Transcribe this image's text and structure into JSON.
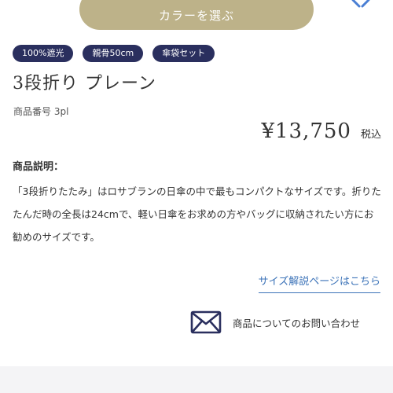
{
  "top_button": {
    "label": "カラーを選ぶ"
  },
  "tags": [
    "100%遮光",
    "親骨50cm",
    "傘袋セット"
  ],
  "product": {
    "title": "3段折り プレーン",
    "number": "商品番号 3pl",
    "price": "¥13,750",
    "tax_label": "税込"
  },
  "description": {
    "heading": "商品説明：",
    "body": "「3段折りたたみ」はロサブランの日傘の中で最もコンパクトなサイズです。折りたたんだ時の全長は24cmで、軽い日傘をお求めの方やバッグに収納されたい方にお勧めのサイズです。"
  },
  "links": {
    "size_guide": "サイズ解説ページはこちら",
    "inquiry": "商品についてのお問い合わせ"
  },
  "colors": {
    "button": "#bdb289",
    "tag": "#2a2f5e",
    "link": "#3c73b8",
    "icon": "#2a2f5e",
    "corner_icon": "#4a7fd4",
    "footer": "#f4f4f6"
  },
  "icons": {
    "inquiry": "mail-icon",
    "top_corner": "chevron-icon"
  }
}
